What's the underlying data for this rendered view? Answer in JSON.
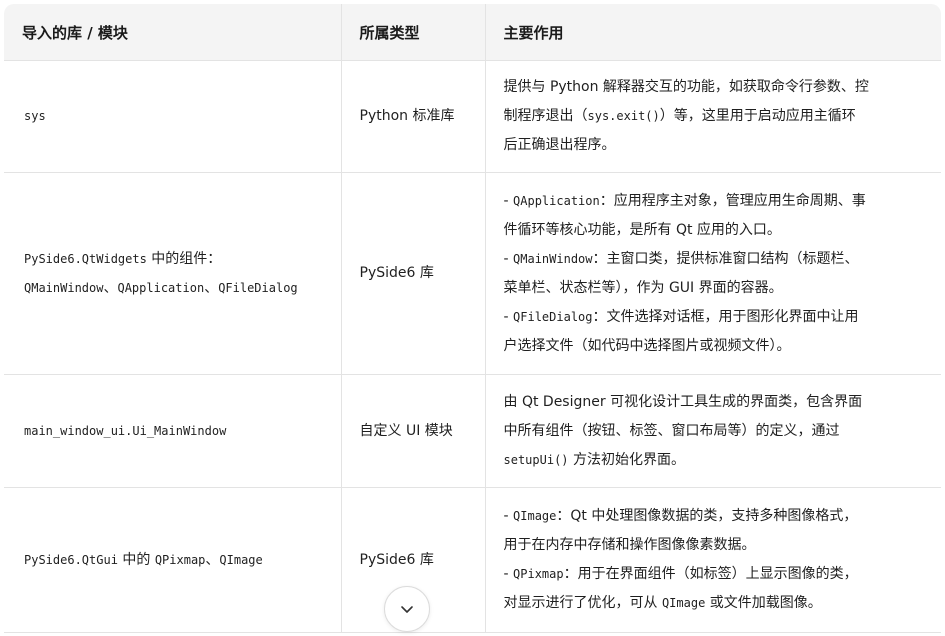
{
  "table": {
    "headers": [
      "导入的库 / 模块",
      "所属类型",
      "主要作用"
    ],
    "rows": [
      {
        "module": [
          {
            "t": "sys",
            "code": true
          }
        ],
        "type": "Python 标准库",
        "desc": [
          [
            {
              "t": "提供与 Python 解释器交互的功能，如获取命令行参数、控"
            }
          ],
          [
            {
              "t": "制程序退出（"
            },
            {
              "t": "sys.exit()",
              "code": true
            },
            {
              "t": "）等，这里用于启动应用主循环"
            }
          ],
          [
            {
              "t": "后正确退出程序。"
            }
          ]
        ]
      },
      {
        "module": [
          [
            {
              "t": "PySide6.QtWidgets",
              "code": true
            },
            {
              "t": " 中的组件："
            }
          ],
          [
            {
              "t": "QMainWindow",
              "code": true
            },
            {
              "t": "、"
            },
            {
              "t": "QApplication",
              "code": true
            },
            {
              "t": "、"
            },
            {
              "t": "QFileDialog",
              "code": true
            }
          ]
        ],
        "type": "PySide6 库",
        "desc": [
          [
            {
              "t": "- "
            },
            {
              "t": "QApplication",
              "code": true
            },
            {
              "t": "：应用程序主对象，管理应用生命周期、事"
            }
          ],
          [
            {
              "t": "件循环等核心功能，是所有 Qt 应用的入口。"
            }
          ],
          [
            {
              "t": "- "
            },
            {
              "t": "QMainWindow",
              "code": true
            },
            {
              "t": "：主窗口类，提供标准窗口结构（标题栏、"
            }
          ],
          [
            {
              "t": "菜单栏、状态栏等），作为 GUI 界面的容器。"
            }
          ],
          [
            {
              "t": "- "
            },
            {
              "t": "QFileDialog",
              "code": true
            },
            {
              "t": "：文件选择对话框，用于图形化界面中让用"
            }
          ],
          [
            {
              "t": "户选择文件（如代码中选择图片或视频文件）。"
            }
          ]
        ]
      },
      {
        "module": [
          {
            "t": "main_window_ui.Ui_MainWindow",
            "code": true
          }
        ],
        "type": "自定义 UI 模块",
        "desc": [
          [
            {
              "t": "由 Qt Designer 可视化设计工具生成的界面类，包含界面"
            }
          ],
          [
            {
              "t": "中所有组件（按钮、标签、窗口布局等）的定义，通过"
            }
          ],
          [
            {
              "t": "setupUi()",
              "code": true
            },
            {
              "t": " 方法初始化界面。"
            }
          ]
        ]
      },
      {
        "module": [
          [
            {
              "t": "PySide6.QtGui",
              "code": true
            },
            {
              "t": " 中的 "
            },
            {
              "t": "QPixmap",
              "code": true
            },
            {
              "t": "、"
            },
            {
              "t": "QImage",
              "code": true
            }
          ]
        ],
        "type": "PySide6 库",
        "desc": [
          [
            {
              "t": "- "
            },
            {
              "t": "QImage",
              "code": true
            },
            {
              "t": "：Qt 中处理图像数据的类，支持多种图像格式，"
            }
          ],
          [
            {
              "t": "用于在内存中存储和操作图像像素数据。"
            }
          ],
          [
            {
              "t": "- "
            },
            {
              "t": "QPixmap",
              "code": true
            },
            {
              "t": "：用于在界面组件（如标签）上显示图像的类，"
            }
          ],
          [
            {
              "t": "对显示进行了优化，可从 "
            },
            {
              "t": "QImage",
              "code": true
            },
            {
              "t": " 或文件加载图像。"
            }
          ]
        ]
      }
    ]
  },
  "scroll_button": {
    "icon": "chevron-down-icon"
  }
}
